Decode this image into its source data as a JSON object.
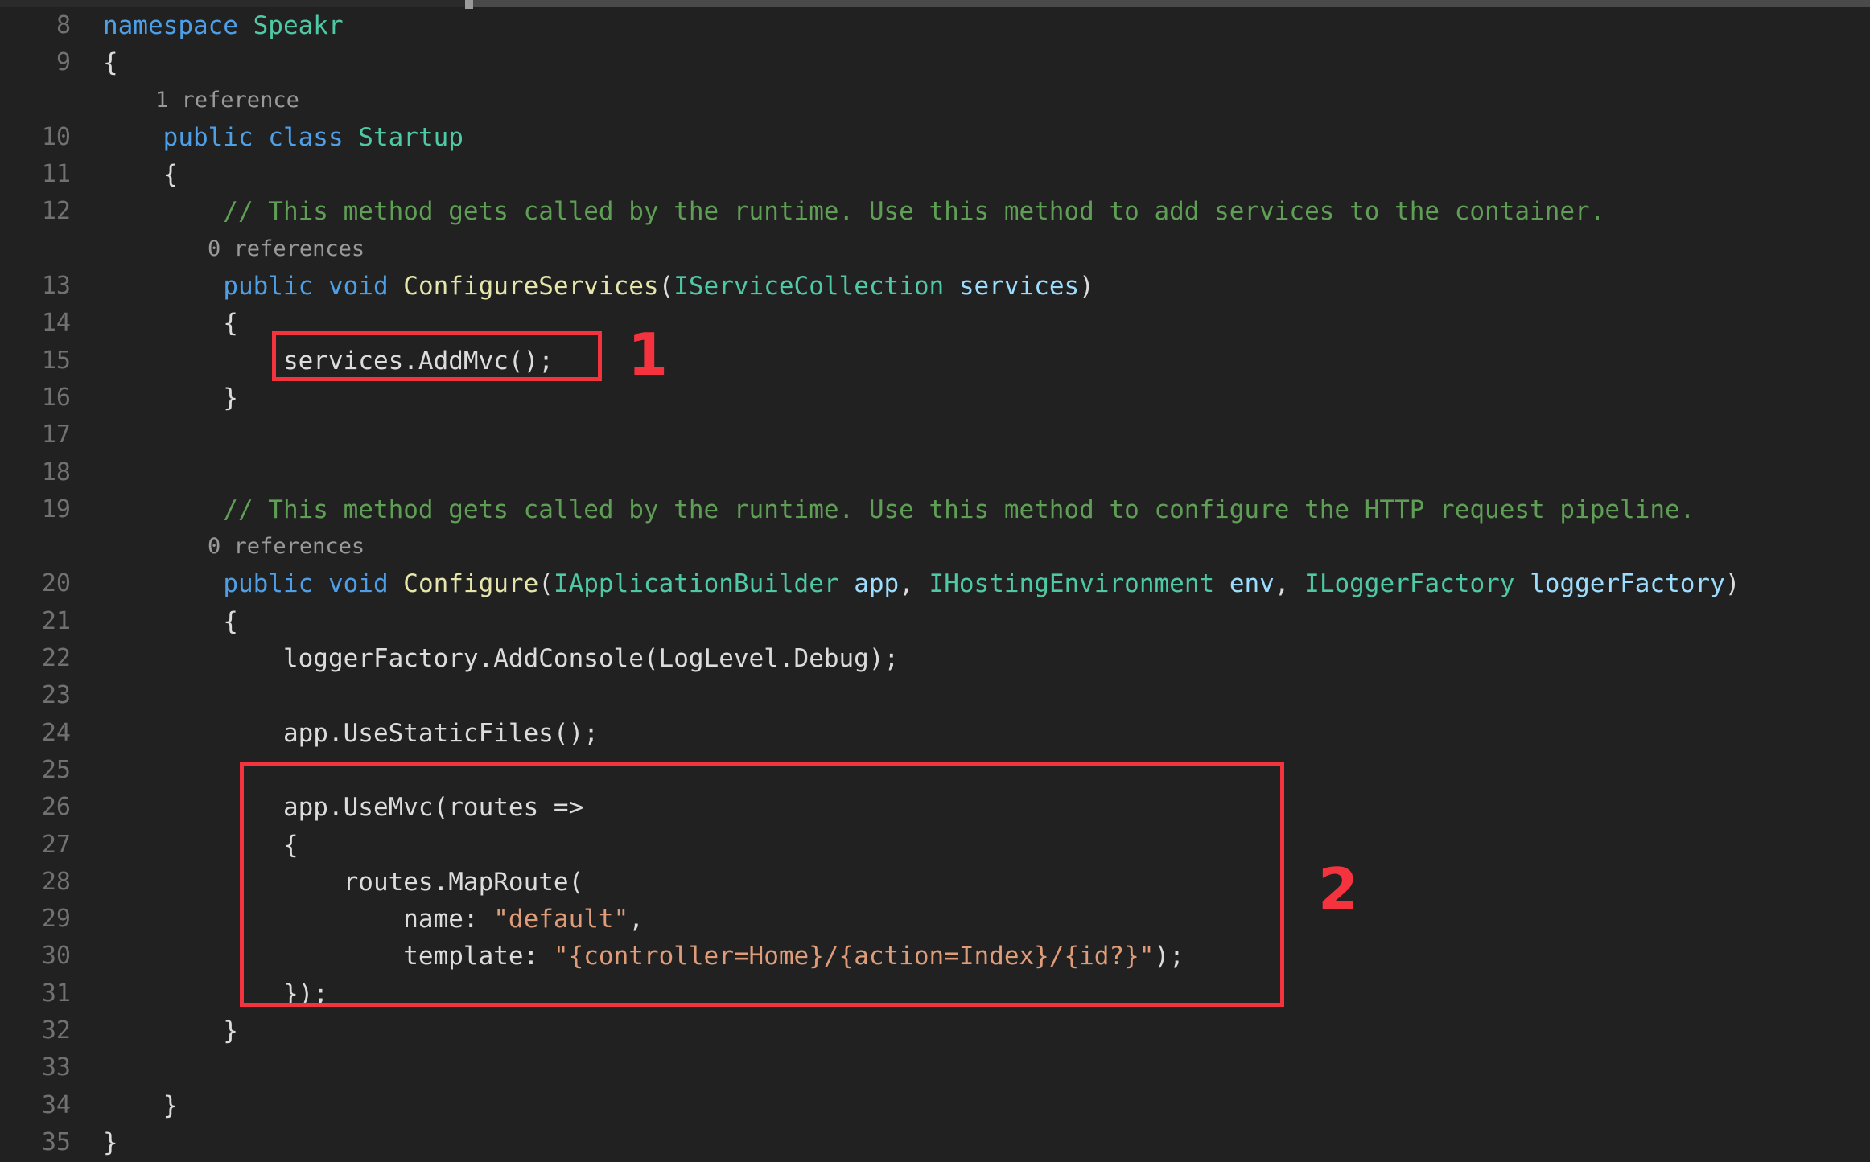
{
  "editor": {
    "language": "csharp",
    "theme": "dark",
    "background_color": "#212121",
    "gutter_color": "#717171",
    "first_visible_line": 8,
    "last_visible_line": 35,
    "scrollbar": {
      "orientation": "horizontal",
      "position": "top"
    }
  },
  "colors": {
    "keyword": "#4d9fe8",
    "type": "#4ec9a5",
    "method": "#e6e6aa",
    "parameter": "#9cdcfe",
    "comment": "#5f9e55",
    "string": "#e09b78",
    "plain": "#dcdcdc",
    "codelens": "#9a9a9a",
    "annotation": "#f5333f"
  },
  "annotations": [
    {
      "id": "annotation-1",
      "label": "1",
      "target_text": "services.AddMvc();",
      "target_line": 15,
      "shape": "rectangle",
      "color": "#f5333f"
    },
    {
      "id": "annotation-2",
      "label": "2",
      "target_text": "app.UseMvc(routes => { routes.MapRoute( name: \"default\", template: \"{controller=Home}/{action=Index}/{id?}\"); });",
      "target_line_start": 26,
      "target_line_end": 31,
      "shape": "rectangle",
      "color": "#f5333f"
    }
  ],
  "lines": [
    {
      "number": "8",
      "tokens": [
        {
          "text": "namespace ",
          "kind": "keyword"
        },
        {
          "text": "Speakr",
          "kind": "type"
        }
      ]
    },
    {
      "number": "9",
      "tokens": [
        {
          "text": "{",
          "kind": "punct"
        }
      ]
    },
    {
      "number": "",
      "codelens": true,
      "tokens": [
        {
          "text": "    1 reference",
          "kind": "lens"
        }
      ]
    },
    {
      "number": "10",
      "tokens": [
        {
          "text": "    ",
          "kind": "plain"
        },
        {
          "text": "public class ",
          "kind": "keyword"
        },
        {
          "text": "Startup",
          "kind": "type"
        }
      ]
    },
    {
      "number": "11",
      "tokens": [
        {
          "text": "    {",
          "kind": "punct"
        }
      ]
    },
    {
      "number": "12",
      "tokens": [
        {
          "text": "        // This method gets called by the runtime. Use this method to add services to the container.",
          "kind": "comment"
        }
      ]
    },
    {
      "number": "",
      "codelens": true,
      "tokens": [
        {
          "text": "        0 references",
          "kind": "lens"
        }
      ]
    },
    {
      "number": "13",
      "tokens": [
        {
          "text": "        ",
          "kind": "plain"
        },
        {
          "text": "public void ",
          "kind": "keyword"
        },
        {
          "text": "ConfigureServices",
          "kind": "method"
        },
        {
          "text": "(",
          "kind": "punct"
        },
        {
          "text": "IServiceCollection",
          "kind": "type"
        },
        {
          "text": " ",
          "kind": "plain"
        },
        {
          "text": "services",
          "kind": "param"
        },
        {
          "text": ")",
          "kind": "punct"
        }
      ]
    },
    {
      "number": "14",
      "tokens": [
        {
          "text": "        {",
          "kind": "punct"
        }
      ]
    },
    {
      "number": "15",
      "tokens": [
        {
          "text": "            services.AddMvc();",
          "kind": "plain"
        }
      ]
    },
    {
      "number": "16",
      "tokens": [
        {
          "text": "        }",
          "kind": "punct"
        }
      ]
    },
    {
      "number": "17",
      "tokens": []
    },
    {
      "number": "18",
      "tokens": []
    },
    {
      "number": "19",
      "tokens": [
        {
          "text": "        // This method gets called by the runtime. Use this method to configure the HTTP request pipeline.",
          "kind": "comment"
        }
      ]
    },
    {
      "number": "",
      "codelens": true,
      "tokens": [
        {
          "text": "        0 references",
          "kind": "lens"
        }
      ]
    },
    {
      "number": "20",
      "tokens": [
        {
          "text": "        ",
          "kind": "plain"
        },
        {
          "text": "public void ",
          "kind": "keyword"
        },
        {
          "text": "Configure",
          "kind": "method"
        },
        {
          "text": "(",
          "kind": "punct"
        },
        {
          "text": "IApplicationBuilder",
          "kind": "type"
        },
        {
          "text": " ",
          "kind": "plain"
        },
        {
          "text": "app",
          "kind": "param"
        },
        {
          "text": ", ",
          "kind": "punct"
        },
        {
          "text": "IHostingEnvironment",
          "kind": "type"
        },
        {
          "text": " ",
          "kind": "plain"
        },
        {
          "text": "env",
          "kind": "param"
        },
        {
          "text": ", ",
          "kind": "punct"
        },
        {
          "text": "ILoggerFactory",
          "kind": "type"
        },
        {
          "text": " ",
          "kind": "plain"
        },
        {
          "text": "loggerFactory",
          "kind": "param"
        },
        {
          "text": ")",
          "kind": "punct"
        }
      ]
    },
    {
      "number": "21",
      "tokens": [
        {
          "text": "        {",
          "kind": "punct"
        }
      ]
    },
    {
      "number": "22",
      "tokens": [
        {
          "text": "            loggerFactory.AddConsole(LogLevel.Debug);",
          "kind": "plain"
        }
      ]
    },
    {
      "number": "23",
      "tokens": []
    },
    {
      "number": "24",
      "tokens": [
        {
          "text": "            app.UseStaticFiles();",
          "kind": "plain"
        }
      ]
    },
    {
      "number": "25",
      "tokens": []
    },
    {
      "number": "26",
      "tokens": [
        {
          "text": "            app.UseMvc(routes =>",
          "kind": "plain"
        }
      ]
    },
    {
      "number": "27",
      "tokens": [
        {
          "text": "            {",
          "kind": "punct"
        }
      ]
    },
    {
      "number": "28",
      "tokens": [
        {
          "text": "                routes.MapRoute(",
          "kind": "plain"
        }
      ]
    },
    {
      "number": "29",
      "tokens": [
        {
          "text": "                    name: ",
          "kind": "plain"
        },
        {
          "text": "\"default\"",
          "kind": "string"
        },
        {
          "text": ",",
          "kind": "punct"
        }
      ]
    },
    {
      "number": "30",
      "tokens": [
        {
          "text": "                    template: ",
          "kind": "plain"
        },
        {
          "text": "\"{controller=Home}/{action=Index}/{id?}\"",
          "kind": "string"
        },
        {
          "text": ");",
          "kind": "punct"
        }
      ]
    },
    {
      "number": "31",
      "tokens": [
        {
          "text": "            });",
          "kind": "punct"
        }
      ]
    },
    {
      "number": "32",
      "tokens": [
        {
          "text": "        }",
          "kind": "punct"
        }
      ]
    },
    {
      "number": "33",
      "tokens": []
    },
    {
      "number": "34",
      "tokens": [
        {
          "text": "    }",
          "kind": "punct"
        }
      ]
    },
    {
      "number": "35",
      "tokens": [
        {
          "text": "}",
          "kind": "punct"
        }
      ]
    }
  ]
}
